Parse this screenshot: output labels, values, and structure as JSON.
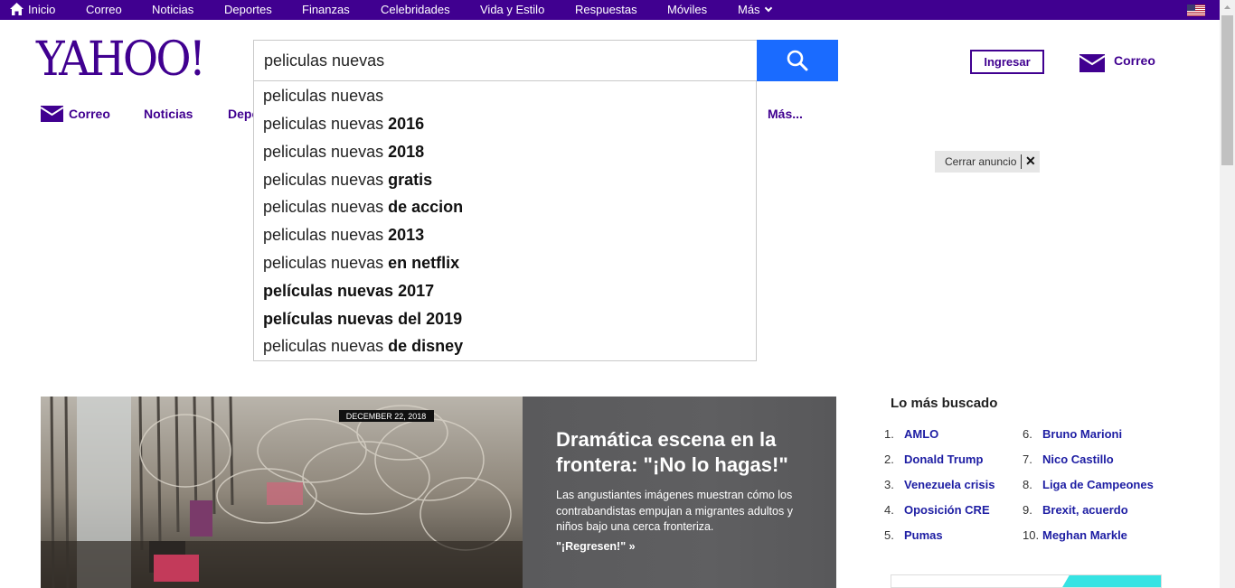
{
  "topbar": {
    "items": [
      "Inicio",
      "Correo",
      "Noticias",
      "Deportes",
      "Finanzas",
      "Celebridades",
      "Vida y Estilo",
      "Respuestas",
      "Móviles",
      "Más"
    ]
  },
  "logo": {
    "text": "YAHOO!"
  },
  "search": {
    "value": "peliculas nuevas",
    "suggestions": [
      {
        "normal": "peliculas nuevas",
        "bold": ""
      },
      {
        "normal": "peliculas nuevas ",
        "bold": "2016"
      },
      {
        "normal": "peliculas nuevas ",
        "bold": "2018"
      },
      {
        "normal": "peliculas nuevas ",
        "bold": "gratis"
      },
      {
        "normal": "peliculas nuevas ",
        "bold": "de accion"
      },
      {
        "normal": "peliculas nuevas ",
        "bold": "2013"
      },
      {
        "normal": "peliculas nuevas ",
        "bold": "en netflix"
      },
      {
        "normal": "",
        "bold": "películas nuevas 2017"
      },
      {
        "normal": "",
        "bold": "películas nuevas del 2019"
      },
      {
        "normal": "peliculas nuevas ",
        "bold": "de disney"
      }
    ]
  },
  "header": {
    "signin_label": "Ingresar",
    "mail_label": "Correo"
  },
  "nav": {
    "items": [
      "Correo",
      "Noticias",
      "Depo",
      "Más..."
    ]
  },
  "ad": {
    "close_label": "Cerrar anuncio",
    "close_symbol": "✕"
  },
  "hero": {
    "image_caption": "DECEMBER 22, 2018",
    "title": "Dramática escena en la frontera: \"¡No lo hagas!\"",
    "description": "Las angustiantes imágenes muestran cómo los contrabandistas empujan a migrantes adultos y niños bajo una cerca fronteriza.",
    "link": "\"¡Regresen!\" »"
  },
  "trending": {
    "title": "Lo más buscado",
    "items": [
      {
        "num": "1.",
        "term": "AMLO"
      },
      {
        "num": "2.",
        "term": "Donald Trump"
      },
      {
        "num": "3.",
        "term": "Venezuela crisis"
      },
      {
        "num": "4.",
        "term": "Oposición CRE"
      },
      {
        "num": "5.",
        "term": "Pumas"
      },
      {
        "num": "6.",
        "term": "Bruno Marioni"
      },
      {
        "num": "7.",
        "term": "Nico Castillo"
      },
      {
        "num": "8.",
        "term": "Liga de Campeones"
      },
      {
        "num": "9.",
        "term": "Brexit, acuerdo"
      },
      {
        "num": "10.",
        "term": "Meghan Markle"
      }
    ]
  },
  "colors": {
    "brand": "#400090",
    "search_button": "#1a6bff",
    "link": "#1d1da3"
  }
}
